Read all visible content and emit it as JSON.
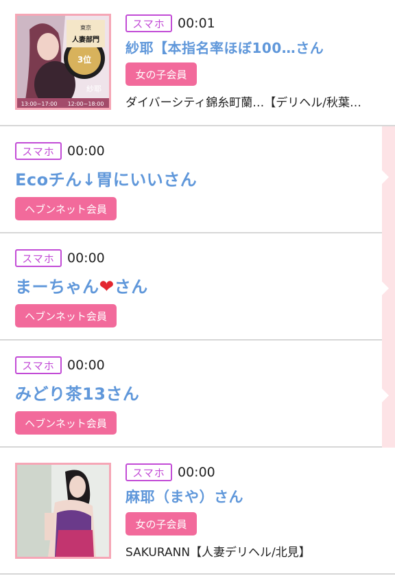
{
  "items": [
    {
      "device": "スマホ",
      "time": "00:01",
      "name": "紗耶【本指名率ほぼ100…さん",
      "member_type": "女の子会員",
      "shop": "ダイバーシティ錦糸町蘭…【デリヘル/秋葉…",
      "has_thumbnail": true
    },
    {
      "device": "スマホ",
      "time": "00:00",
      "name": "Ecoチん↓胃にいいさん",
      "member_type": "ヘブンネット会員",
      "has_thumbnail": false
    },
    {
      "device": "スマホ",
      "time": "00:00",
      "name_prefix": "まーちゃん",
      "name_heart": "❤",
      "name_suffix": "さん",
      "member_type": "ヘブンネット会員",
      "has_thumbnail": false
    },
    {
      "device": "スマホ",
      "time": "00:00",
      "name": "みどり茶13さん",
      "member_type": "ヘブンネット会員",
      "has_thumbnail": false
    },
    {
      "device": "スマホ",
      "time": "00:00",
      "name": "麻耶（まや）さん",
      "member_type": "女の子会員",
      "shop": "SAKURANN【人妻デリヘル/北見】",
      "has_thumbnail": true
    }
  ],
  "thumb1": {
    "banner_top": "東京",
    "banner_mid": "人妻部門",
    "rank": "3位",
    "side_text": "紗耶",
    "hours_left": "13:00~17:00",
    "hours_right": "12:00~18:00"
  },
  "colors": {
    "name_blue": "#5f97da",
    "member_pink": "#f26a9b",
    "device_purple": "#c24bd6",
    "thumb_border": "#f6a6b6",
    "stripe": "#fde3e6"
  }
}
